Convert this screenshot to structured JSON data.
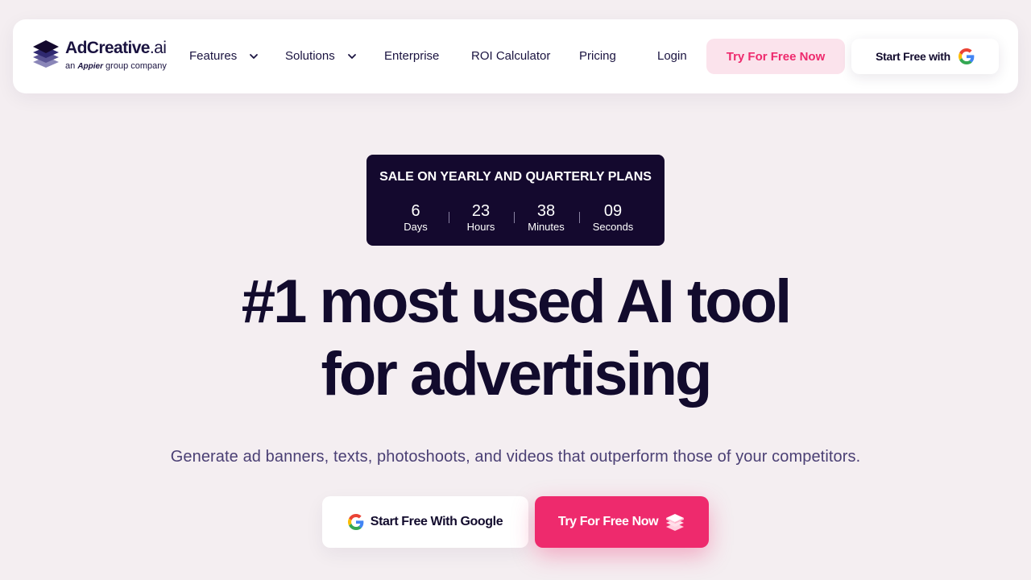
{
  "nav": {
    "logo": {
      "name_main": "AdCreative",
      "name_suffix": ".ai",
      "sub_prefix": "an",
      "sub_brand": "Appier",
      "sub_suffix": "group company"
    },
    "items": [
      {
        "label": "Features",
        "has_dropdown": true
      },
      {
        "label": "Solutions",
        "has_dropdown": true
      },
      {
        "label": "Enterprise",
        "has_dropdown": false
      },
      {
        "label": "ROI Calculator",
        "has_dropdown": false
      },
      {
        "label": "Pricing",
        "has_dropdown": false
      }
    ],
    "login_label": "Login",
    "try_label": "Try For Free Now",
    "google_label": "Start Free with"
  },
  "sale": {
    "title": "SALE ON YEARLY AND QUARTERLY PLANS",
    "countdown": [
      {
        "value": "6",
        "unit": "Days"
      },
      {
        "value": "23",
        "unit": "Hours"
      },
      {
        "value": "38",
        "unit": "Minutes"
      },
      {
        "value": "09",
        "unit": "Seconds"
      }
    ]
  },
  "hero": {
    "headline_line1": "#1 most used AI tool",
    "headline_line2": "for advertising",
    "subtitle": "Generate ad banners, texts, photoshoots, and videos that outperform those of your competitors.",
    "google_button": "Start Free With Google",
    "try_button": "Try For Free Now"
  },
  "colors": {
    "background": "#f4eef1",
    "navy": "#120b2d",
    "accent_pink": "#ee2a6d",
    "pink_light": "#fbe3ec",
    "sale_bg": "#14092e"
  },
  "icons": [
    "logo-stack-icon",
    "chevron-down-icon",
    "google-g-icon",
    "cube-stack-icon"
  ]
}
